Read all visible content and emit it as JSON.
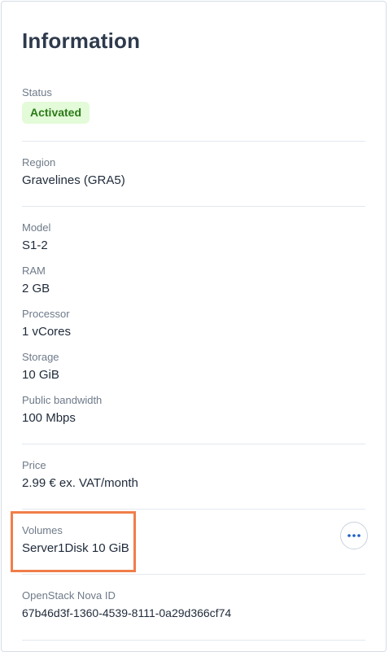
{
  "panel": {
    "title": "Information"
  },
  "status": {
    "label": "Status",
    "value": "Activated",
    "badge_bg": "#e3fbd8",
    "badge_fg": "#2b7a18"
  },
  "region": {
    "label": "Region",
    "value": "Gravelines (GRA5)"
  },
  "model": {
    "label": "Model",
    "value": "S1-2"
  },
  "ram": {
    "label": "RAM",
    "value": "2 GB"
  },
  "processor": {
    "label": "Processor",
    "value": "1 vCores"
  },
  "storage": {
    "label": "Storage",
    "value": "10 GiB"
  },
  "bandwidth": {
    "label": "Public bandwidth",
    "value": "100 Mbps"
  },
  "price": {
    "label": "Price",
    "value": "2.99 € ex. VAT/month"
  },
  "volumes": {
    "label": "Volumes",
    "value": "Server1Disk 10 GiB",
    "actions_icon": "more-horizontal-icon",
    "highlight_color": "#f07e4a"
  },
  "openstack": {
    "label": "OpenStack Nova ID",
    "value": "67b46d3f-1360-4539-8111-0a29d366cf74"
  }
}
